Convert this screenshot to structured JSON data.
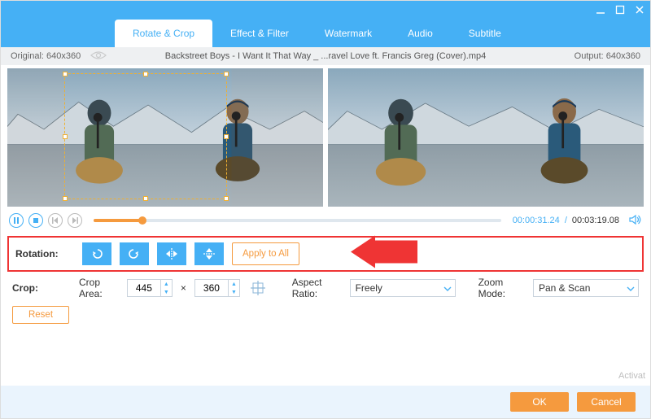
{
  "window": {
    "minimize": "—",
    "maximize": "☐",
    "close": "✕"
  },
  "tabs": {
    "rotate_crop": "Rotate & Crop",
    "effect_filter": "Effect & Filter",
    "watermark": "Watermark",
    "audio": "Audio",
    "subtitle": "Subtitle"
  },
  "infobar": {
    "original_label": "Original: 640x360",
    "filename": "Backstreet Boys - I Want It That Way _ ...ravel Love ft. Francis Greg (Cover).mp4",
    "output_label": "Output: 640x360"
  },
  "playback": {
    "current": "00:00:31.24",
    "sep": "/",
    "total": "00:03:19.08"
  },
  "rotation": {
    "label": "Rotation:",
    "apply_all": "Apply to All"
  },
  "crop": {
    "label": "Crop:",
    "area_label": "Crop Area:",
    "width": "445",
    "times": "×",
    "height": "360",
    "aspect_label": "Aspect Ratio:",
    "aspect_value": "Freely",
    "zoom_label": "Zoom Mode:",
    "zoom_value": "Pan & Scan",
    "reset": "Reset"
  },
  "footer": {
    "ok": "OK",
    "cancel": "Cancel"
  },
  "watermark_text": "Activat"
}
